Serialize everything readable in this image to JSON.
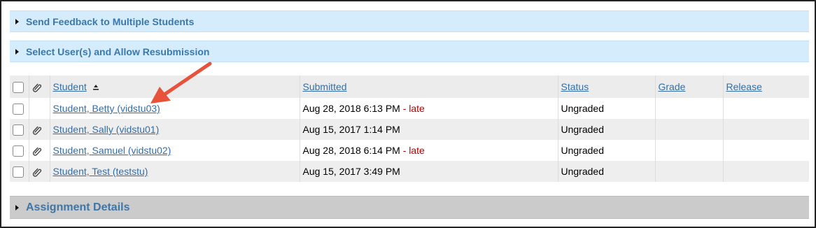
{
  "sections": {
    "send_feedback": "Send Feedback to Multiple Students",
    "allow_resubmission": "Select User(s) and Allow Resubmission",
    "assignment_details": "Assignment Details"
  },
  "table": {
    "columns": {
      "student": "Student",
      "submitted": "Submitted",
      "status": "Status",
      "grade": "Grade",
      "release": "Release"
    },
    "rows": [
      {
        "student": "Student, Betty (vidstu03)",
        "submitted": "Aug 28, 2018 6:13 PM",
        "late": "- late",
        "status": "Ungraded",
        "grade": "",
        "release": "",
        "has_attachment": false
      },
      {
        "student": "Student, Sally (vidstu01)",
        "submitted": "Aug 15, 2017 1:14 PM",
        "late": "",
        "status": "Ungraded",
        "grade": "",
        "release": "",
        "has_attachment": true
      },
      {
        "student": "Student, Samuel (vidstu02)",
        "submitted": "Aug 28, 2018 6:14 PM",
        "late": "- late",
        "status": "Ungraded",
        "grade": "",
        "release": "",
        "has_attachment": true
      },
      {
        "student": "Student, Test (teststu)",
        "submitted": "Aug 15, 2017 3:49 PM",
        "late": "",
        "status": "Ungraded",
        "grade": "",
        "release": "",
        "has_attachment": true
      }
    ]
  },
  "icons": {
    "attachment": "paperclip-icon",
    "sort": "sort-ascending-icon",
    "expand": "triangle-right-icon",
    "annotation": "red-arrow-annotation"
  },
  "colors": {
    "link": "#336ea8",
    "section_bar": "#d4ecfb",
    "details_bar": "#cbcbcb",
    "late": "#b20000",
    "annotation_arrow": "#e8513a"
  }
}
